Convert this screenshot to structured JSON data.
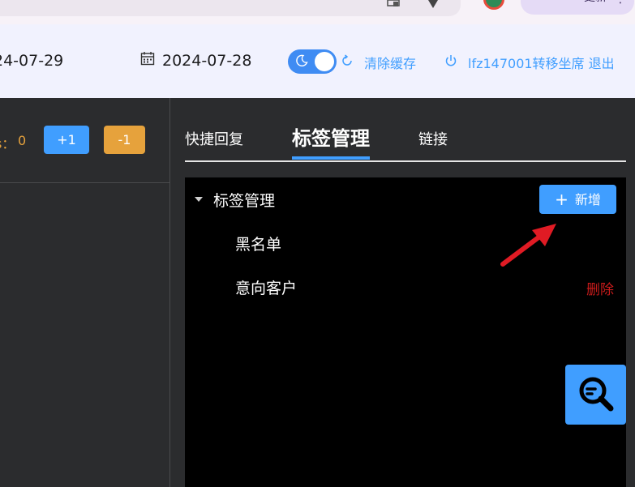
{
  "browser": {
    "update_label": "更新",
    "menu_icon": "vertical-dots-icon"
  },
  "header": {
    "date_left": "24-07-29",
    "date_right": "2024-07-28",
    "clear_cache": "清除缓存",
    "user_text": "lfz147001转移坐席 退出",
    "theme_toggle_on": true
  },
  "left_panel": {
    "counter_label": "s：",
    "counter_value": "0",
    "plus_button": "+1",
    "minus_button": "-1"
  },
  "right_panel": {
    "tabs": [
      {
        "label": "快捷回复",
        "active": false
      },
      {
        "label": "标签管理",
        "active": true
      },
      {
        "label": "链接",
        "active": false
      }
    ],
    "tree": {
      "root_label": "标签管理",
      "add_button": "新增",
      "items": [
        {
          "label": "黑名单"
        },
        {
          "label": "意向客户",
          "delete_label": "删除"
        }
      ]
    }
  },
  "colors": {
    "accent": "#409eff",
    "warning": "#e6a23c",
    "danger": "#c91b1b",
    "header_bg": "#f1f2fe",
    "panel_bg": "#2b2c2e"
  }
}
